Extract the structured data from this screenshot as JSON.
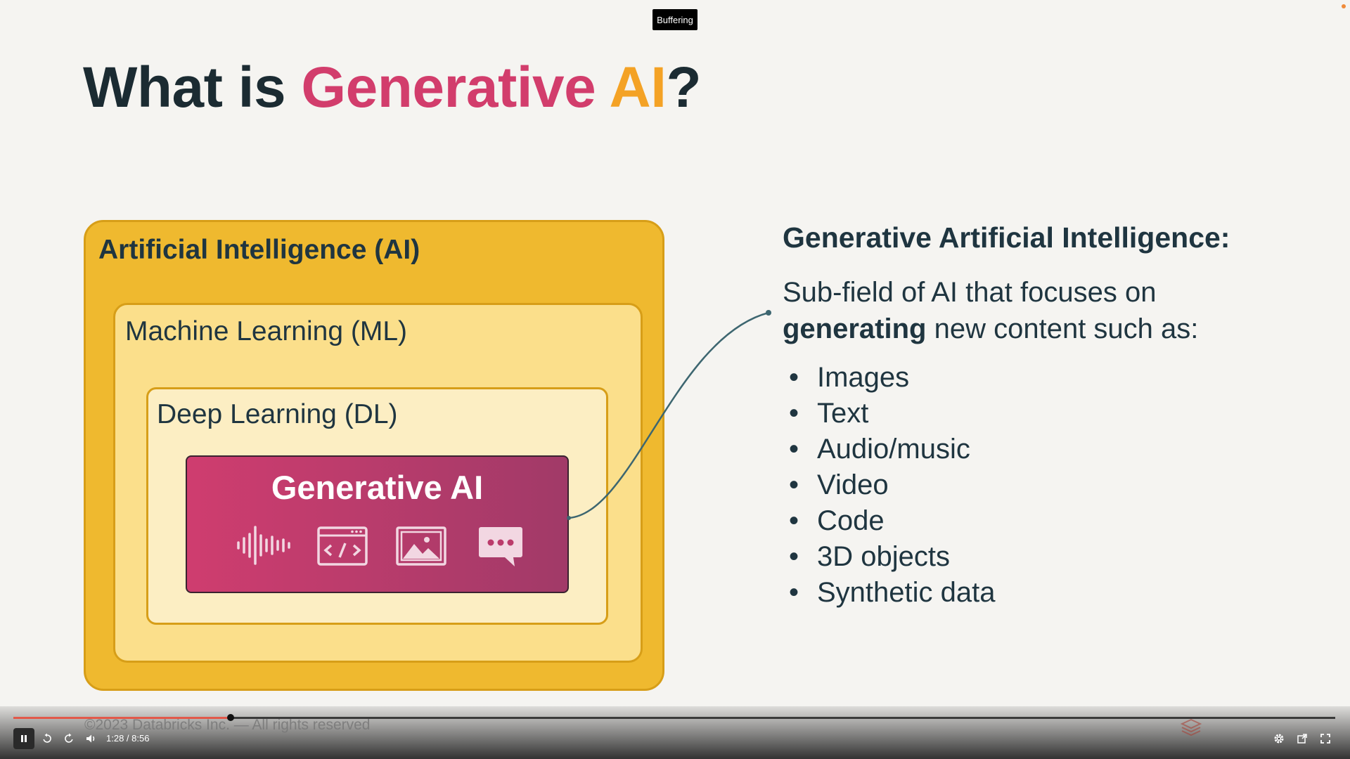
{
  "player": {
    "status_badge": "Buffering",
    "time_display": "1:28 / 8:56",
    "progress_fraction": 0.1642
  },
  "slide": {
    "title": {
      "prefix": "What is ",
      "highlight1": "Generative",
      "space": " ",
      "highlight2": "AI",
      "suffix": "?"
    },
    "diagram": {
      "ai_label": "Artificial Intelligence (AI)",
      "ml_label": "Machine Learning (ML)",
      "dl_label": "Deep Learning (DL)",
      "gen_label": "Generative AI",
      "icons": [
        "audio-waveform-icon",
        "code-window-icon",
        "image-icon",
        "chat-bubble-icon"
      ]
    },
    "definition": {
      "heading": "Generative Artificial Intelligence:",
      "line1": "Sub-field of AI that focuses on",
      "bold_word": "generating",
      "line2_rest": " new content such as:",
      "items": [
        "Images",
        "Text",
        "Audio/music",
        "Video",
        "Code",
        "3D objects",
        "Synthetic data"
      ]
    },
    "footer": "©2023 Databricks Inc. — All rights reserved"
  },
  "colors": {
    "title_generative": "#d23d6c",
    "title_ai": "#f4a225",
    "ai_box": "#efb92f",
    "ml_box": "#fbdf8b",
    "dl_box": "#fceec3",
    "gen_box": "#c23c6d",
    "progress": "#e2594a"
  }
}
